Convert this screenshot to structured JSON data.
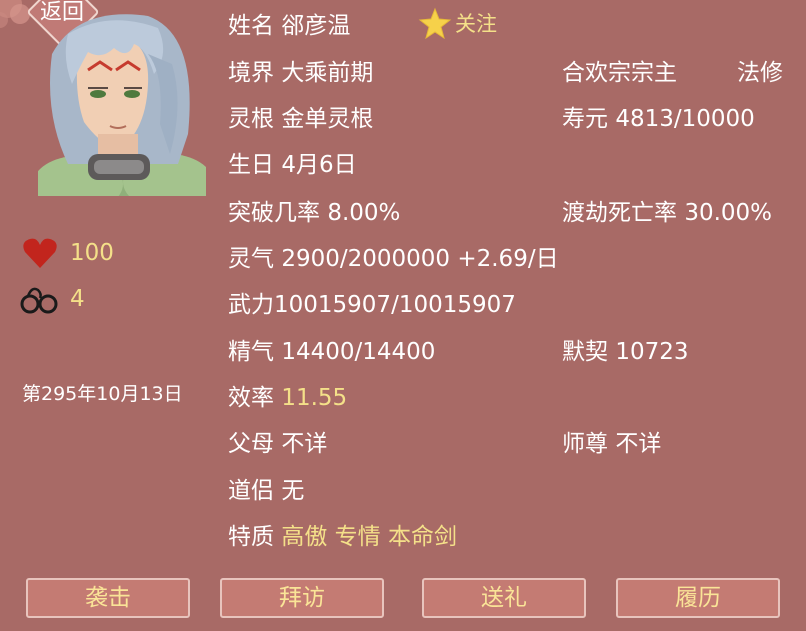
{
  "header": {
    "back_label": "返回",
    "follow_label": "关注"
  },
  "side": {
    "health": "100",
    "shackles": "4",
    "date": "第295年10月13日"
  },
  "info": {
    "name_label": "姓名",
    "name": "郤彦温",
    "realm_label": "境界",
    "realm": "大乘前期",
    "sect": "合欢宗宗主",
    "path": "法修",
    "root_label": "灵根",
    "root": "金单灵根",
    "lifespan_label": "寿元",
    "lifespan": "4813/10000",
    "birthday_label": "生日",
    "birthday": "4月6日",
    "breakthrough_label": "突破几率",
    "breakthrough": "8.00%",
    "tribulation_label": "渡劫死亡率",
    "tribulation": "30.00%",
    "qi_label": "灵气",
    "qi": "2900/2000000 +2.69/日",
    "force_label": "武力",
    "force": "10015907/10015907",
    "essence_label": "精气",
    "essence": "14400/14400",
    "bond_label": "默契",
    "bond": "10723",
    "efficiency_label": "效率",
    "efficiency": "11.55",
    "parents_label": "父母",
    "parents": "不详",
    "master_label": "师尊",
    "master": "不详",
    "partner_label": "道侣",
    "partner": "无",
    "traits_label": "特质",
    "traits": [
      "高傲",
      "专情",
      "本命剑"
    ]
  },
  "actions": {
    "attack": "袭击",
    "visit": "拜访",
    "gift": "送礼",
    "history": "履历"
  },
  "colors": {
    "background": "#a86a66",
    "highlight": "#f4e089",
    "button": "#c47b73"
  }
}
